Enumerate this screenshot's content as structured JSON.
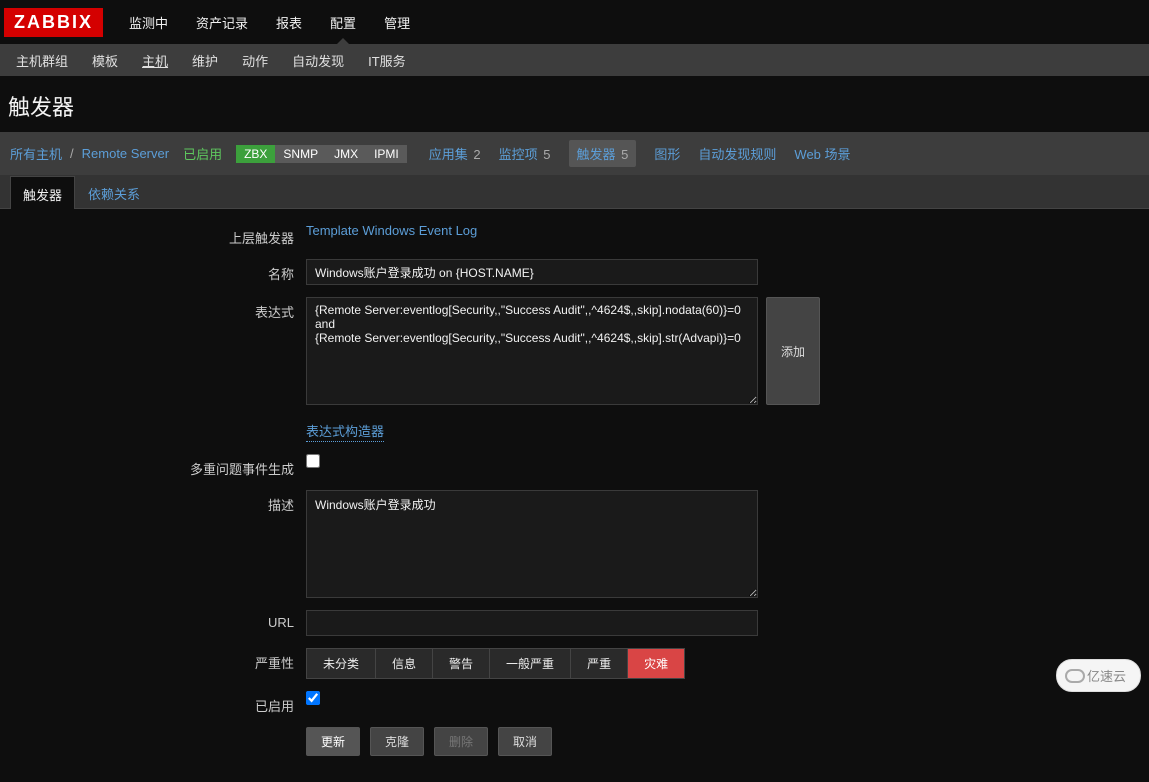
{
  "logo": "ZABBIX",
  "topnav": {
    "monitoring": "监测中",
    "inventory": "资产记录",
    "reports": "报表",
    "configuration": "配置",
    "administration": "管理"
  },
  "subnav": {
    "hostgroups": "主机群组",
    "templates": "模板",
    "hosts": "主机",
    "maintenance": "维护",
    "actions": "动作",
    "discovery": "自动发现",
    "itservices": "IT服务"
  },
  "page_title": "触发器",
  "hostbar": {
    "all_hosts": "所有主机",
    "host_name": "Remote Server",
    "status": "已启用",
    "iface": {
      "zbx": "ZBX",
      "snmp": "SNMP",
      "jmx": "JMX",
      "ipmi": "IPMI"
    },
    "applications": "应用集",
    "applications_count": "2",
    "items": "监控项",
    "items_count": "5",
    "triggers": "触发器",
    "triggers_count": "5",
    "graphs": "图形",
    "discovery": "自动发现规则",
    "web": "Web 场景"
  },
  "tabs": {
    "trigger": "触发器",
    "dependencies": "依赖关系"
  },
  "form": {
    "parent_label": "上层触发器",
    "parent_value": "Template Windows Event Log",
    "name_label": "名称",
    "name_value": "Windows账户登录成功 on {HOST.NAME}",
    "expression_label": "表达式",
    "expression_value": "{Remote Server:eventlog[Security,,\"Success Audit\",,^4624$,,skip].nodata(60)}=0 and\n{Remote Server:eventlog[Security,,\"Success Audit\",,^4624$,,skip].str(Advapi)}=0",
    "add_btn": "添加",
    "expr_constructor": "表达式构造器",
    "multiple_label": "多重问题事件生成",
    "multiple_checked": false,
    "description_label": "描述",
    "description_value": "Windows账户登录成功",
    "url_label": "URL",
    "url_value": "",
    "severity_label": "严重性",
    "severity": {
      "not_classified": "未分类",
      "information": "信息",
      "warning": "警告",
      "average": "一般严重",
      "high": "严重",
      "disaster": "灾难"
    },
    "enabled_label": "已启用",
    "enabled_checked": true,
    "buttons": {
      "update": "更新",
      "clone": "克隆",
      "delete": "删除",
      "cancel": "取消"
    }
  },
  "watermark": "亿速云"
}
